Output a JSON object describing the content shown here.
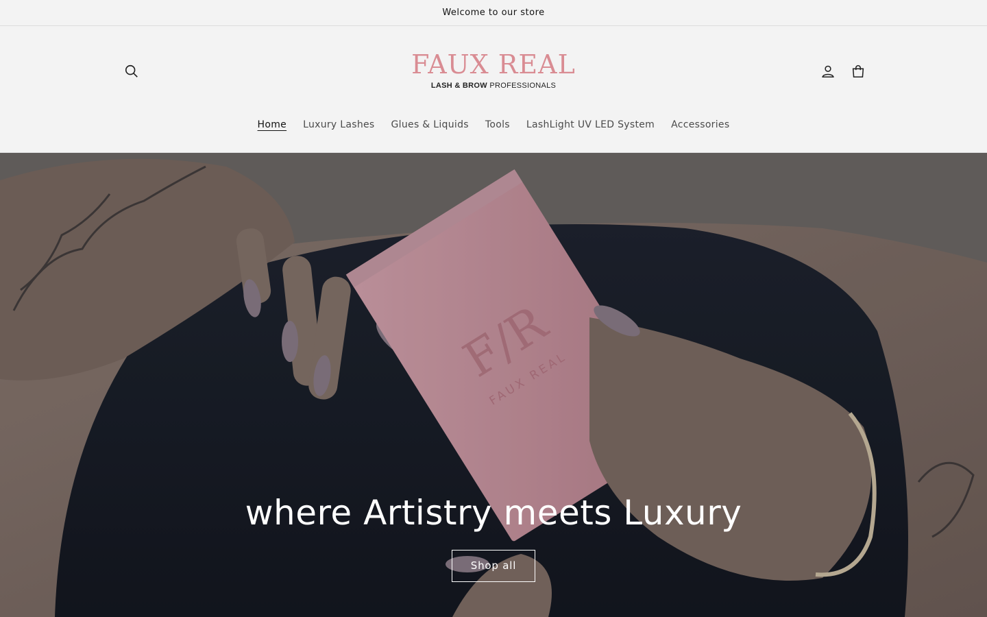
{
  "announcement": {
    "text": "Welcome to our store"
  },
  "header": {
    "logo": {
      "main": "FAUX REAL",
      "sub_bold": "LASH & BROW",
      "sub_rest": "PROFESSIONALS"
    },
    "icons": {
      "search": "search-icon",
      "account": "user-icon",
      "cart": "cart-icon"
    }
  },
  "nav": {
    "items": [
      {
        "label": "Home",
        "active": true
      },
      {
        "label": "Luxury Lashes"
      },
      {
        "label": "Glues & Liquids"
      },
      {
        "label": "Tools"
      },
      {
        "label": "LashLight UV LED System"
      },
      {
        "label": "Accessories"
      }
    ]
  },
  "hero": {
    "title": "where Artistry meets Luxury",
    "button": "Shop all",
    "box_monogram": "F/R",
    "box_text": "FAUX REAL"
  },
  "colors": {
    "brand": "#d98c93",
    "box_pink": "#c9939f",
    "nail": "#8a7c88"
  }
}
